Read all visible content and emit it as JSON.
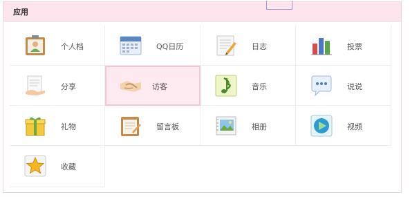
{
  "header": {
    "title": "应用"
  },
  "apps": [
    {
      "label": "个人档",
      "icon": "profile-icon"
    },
    {
      "label": "QQ日历",
      "icon": "calendar-icon"
    },
    {
      "label": "日志",
      "icon": "diary-icon"
    },
    {
      "label": "投票",
      "icon": "vote-chart-icon"
    },
    {
      "label": "分享",
      "icon": "share-icon"
    },
    {
      "label": "访客",
      "icon": "handshake-icon"
    },
    {
      "label": "音乐",
      "icon": "music-note-icon"
    },
    {
      "label": "说说",
      "icon": "speech-bubble-icon"
    },
    {
      "label": "礼物",
      "icon": "gift-icon"
    },
    {
      "label": "留言板",
      "icon": "message-board-icon"
    },
    {
      "label": "相册",
      "icon": "photo-album-icon"
    },
    {
      "label": "视频",
      "icon": "video-play-icon"
    },
    {
      "label": "收藏",
      "icon": "favorite-star-icon"
    }
  ],
  "colors": {
    "header_bg": "#fde5ee",
    "active_bg": "#fde9f0",
    "active_border": "#f2c4d6"
  }
}
